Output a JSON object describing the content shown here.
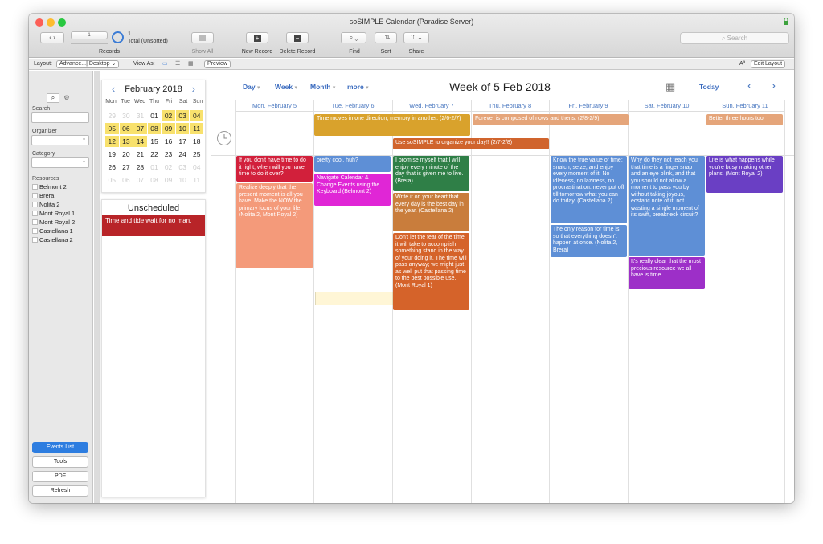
{
  "window": {
    "title": "soSIMPLE Calendar (Paradise Server)"
  },
  "toolbar": {
    "records_count": "1",
    "records_total": "Total (Unsorted)",
    "records_label": "Records",
    "show_all_label": "Show All",
    "new_record_label": "New Record",
    "delete_record_label": "Delete Record",
    "find_label": "Find",
    "sort_label": "Sort",
    "share_label": "Share",
    "search_placeholder": "Search"
  },
  "layout_bar": {
    "layout_label": "Layout:",
    "layout_value": "Advance...| Desktop",
    "view_as_label": "View As:",
    "preview_label": "Preview",
    "aa_label": "Aª",
    "edit_layout_label": "Edit Layout"
  },
  "sidebar": {
    "search_label": "Search",
    "organizer_label": "Organizer",
    "category_label": "Category",
    "resources_label": "Resources",
    "resources": [
      "Belmont 2",
      "Brera",
      "Nolita 2",
      "Mont Royal 1",
      "Mont Royal 2",
      "Castellana 1",
      "Castellana 2"
    ],
    "buttons": {
      "events_list": "Events List",
      "tools": "Tools",
      "pdf": "PDF",
      "refresh": "Refresh"
    }
  },
  "minical": {
    "month": "February 2018",
    "dows": [
      "Mon",
      "Tue",
      "Wed",
      "Thu",
      "Fri",
      "Sat",
      "Sun"
    ],
    "weeks": [
      [
        [
          "29",
          "o"
        ],
        [
          "30",
          "o"
        ],
        [
          "31",
          "o"
        ],
        [
          "01",
          ""
        ],
        [
          "02",
          "hl"
        ],
        [
          "03",
          "hl"
        ],
        [
          "04",
          "hl"
        ]
      ],
      [
        [
          "05",
          "hl"
        ],
        [
          "06",
          "hl"
        ],
        [
          "07",
          "hl"
        ],
        [
          "08",
          "hl"
        ],
        [
          "09",
          "hl"
        ],
        [
          "10",
          "hl"
        ],
        [
          "11",
          "hl"
        ]
      ],
      [
        [
          "12",
          "hl"
        ],
        [
          "13",
          "hl"
        ],
        [
          "14",
          "hl"
        ],
        [
          "15",
          ""
        ],
        [
          "16",
          ""
        ],
        [
          "17",
          ""
        ],
        [
          "18",
          ""
        ]
      ],
      [
        [
          "19",
          ""
        ],
        [
          "20",
          ""
        ],
        [
          "21",
          ""
        ],
        [
          "22",
          ""
        ],
        [
          "23",
          ""
        ],
        [
          "24",
          ""
        ],
        [
          "25",
          ""
        ]
      ],
      [
        [
          "26",
          ""
        ],
        [
          "27",
          ""
        ],
        [
          "28",
          ""
        ],
        [
          "01",
          "o"
        ],
        [
          "02",
          "o"
        ],
        [
          "03",
          "o"
        ],
        [
          "04",
          "o"
        ]
      ],
      [
        [
          "05",
          "o"
        ],
        [
          "06",
          "o"
        ],
        [
          "07",
          "o"
        ],
        [
          "08",
          "o"
        ],
        [
          "09",
          "o"
        ],
        [
          "10",
          "o"
        ],
        [
          "11",
          "o"
        ]
      ]
    ]
  },
  "unscheduled": {
    "title": "Unscheduled",
    "events": [
      {
        "text": "Time and tide wait for no man.",
        "color": "#b82428"
      }
    ]
  },
  "calendar": {
    "views": [
      "Day",
      "Week",
      "Month",
      "more"
    ],
    "week_title": "Week of 5 Feb 2018",
    "today_label": "Today",
    "days": [
      "Mon, February 5",
      "Tue, February 6",
      "Wed, February 7",
      "Thu, February 8",
      "Fri, February 9",
      "Sat, February 10",
      "Sun, February 11"
    ],
    "allday_events": [
      {
        "text": "Time moves in one direction, memory in another. (2/6-2/7)",
        "color": "#d9a22c"
      },
      {
        "text": "Forever is composed of nows and thens. (2/8-2/9)",
        "color": "#e5a57a"
      },
      {
        "text": "Better three hours too",
        "color": "#e5a57a"
      },
      {
        "text": "Use soSIMPLE to organize your day!! (2/7-2/8)",
        "color": "#d0642d"
      }
    ],
    "events": [
      {
        "text": "If you don't have time to do it right, when will you have time to do it over?",
        "color": "#d2203b"
      },
      {
        "text": "Realize deeply that the present moment is all you have. Make the NOW the primary focus of your life. (Nolita 2, Mont Royal 2)",
        "color": "#f49a7a"
      },
      {
        "text": "pretty cool, huh?",
        "color": "#5e8fd6"
      },
      {
        "text": "Navigate Calendar & Change Events using the Keyboard (Belmont 2)",
        "color": "#e026d6"
      },
      {
        "text": "I promise myself that I will enjoy every minute of the day that is given me to live. (Brera)",
        "color": "#2f7f47"
      },
      {
        "text": "Write it on your heart that every day is the best day in the year. (Castellana 2)",
        "color": "#c97d3c"
      },
      {
        "text": "Don't let the fear of the time it will take to accomplish something stand in the way of your doing it. The time will pass anyway; we might just as well put that passing time to the best possible use. (Mont Royal 1)",
        "color": "#d5632a"
      },
      {
        "text": "Know the true value of time; snatch, seize, and enjoy every moment of it. No idleness, no laziness, no procrastination: never put off till tomorrow what you can do today. (Castellana 2)",
        "color": "#5e8fd6"
      },
      {
        "text": "The only reason for time is so that everything doesn't happen at once. (Nolita 2, Brera)",
        "color": "#5e8fd6"
      },
      {
        "text": "Why do they not teach you that time is a finger snap and an eye blink, and that you should not allow a moment to pass you by without taking joyous, ecstatic note of it, not wasting a single moment of its swift, breakneck circuit?",
        "color": "#5e8fd6"
      },
      {
        "text": "It's really clear that the most precious resource we all have is time.",
        "color": "#9d2fc8"
      },
      {
        "text": "Life is what happens while you're busy making other plans. (Mont Royal 2)",
        "color": "#6a3fc4"
      }
    ]
  }
}
